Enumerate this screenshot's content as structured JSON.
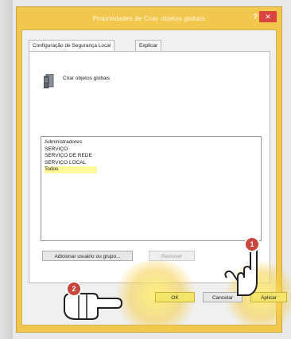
{
  "window": {
    "title": "Propriedades de Criar objetos globais",
    "help_label": "?",
    "close_label": "✕"
  },
  "tabs": [
    {
      "label": "Configuração de Segurança Local",
      "active": true
    },
    {
      "label": "Explicar",
      "active": false
    }
  ],
  "object": {
    "icon": "server-icon",
    "name": "Criar objetos globais"
  },
  "members": [
    {
      "label": "Administradores",
      "selected": false
    },
    {
      "label": "SERVIÇO",
      "selected": false
    },
    {
      "label": "SERVIÇO DE REDE",
      "selected": false
    },
    {
      "label": "SERVIÇO LOCAL",
      "selected": false
    },
    {
      "label": "Todos",
      "selected": true
    }
  ],
  "actions": {
    "add_label": "Adicionar usuário ou grupo...",
    "remove_label": "Remover"
  },
  "footer": {
    "ok_label": "OK",
    "cancel_label": "Cancelar",
    "apply_label": "Aplicar"
  },
  "annotations": {
    "step1": "1",
    "step2": "2"
  },
  "colors": {
    "window_frame": "#f2c74d",
    "close_button": "#d9443f",
    "highlight": "#fff99a",
    "badge": "#c9463d"
  }
}
